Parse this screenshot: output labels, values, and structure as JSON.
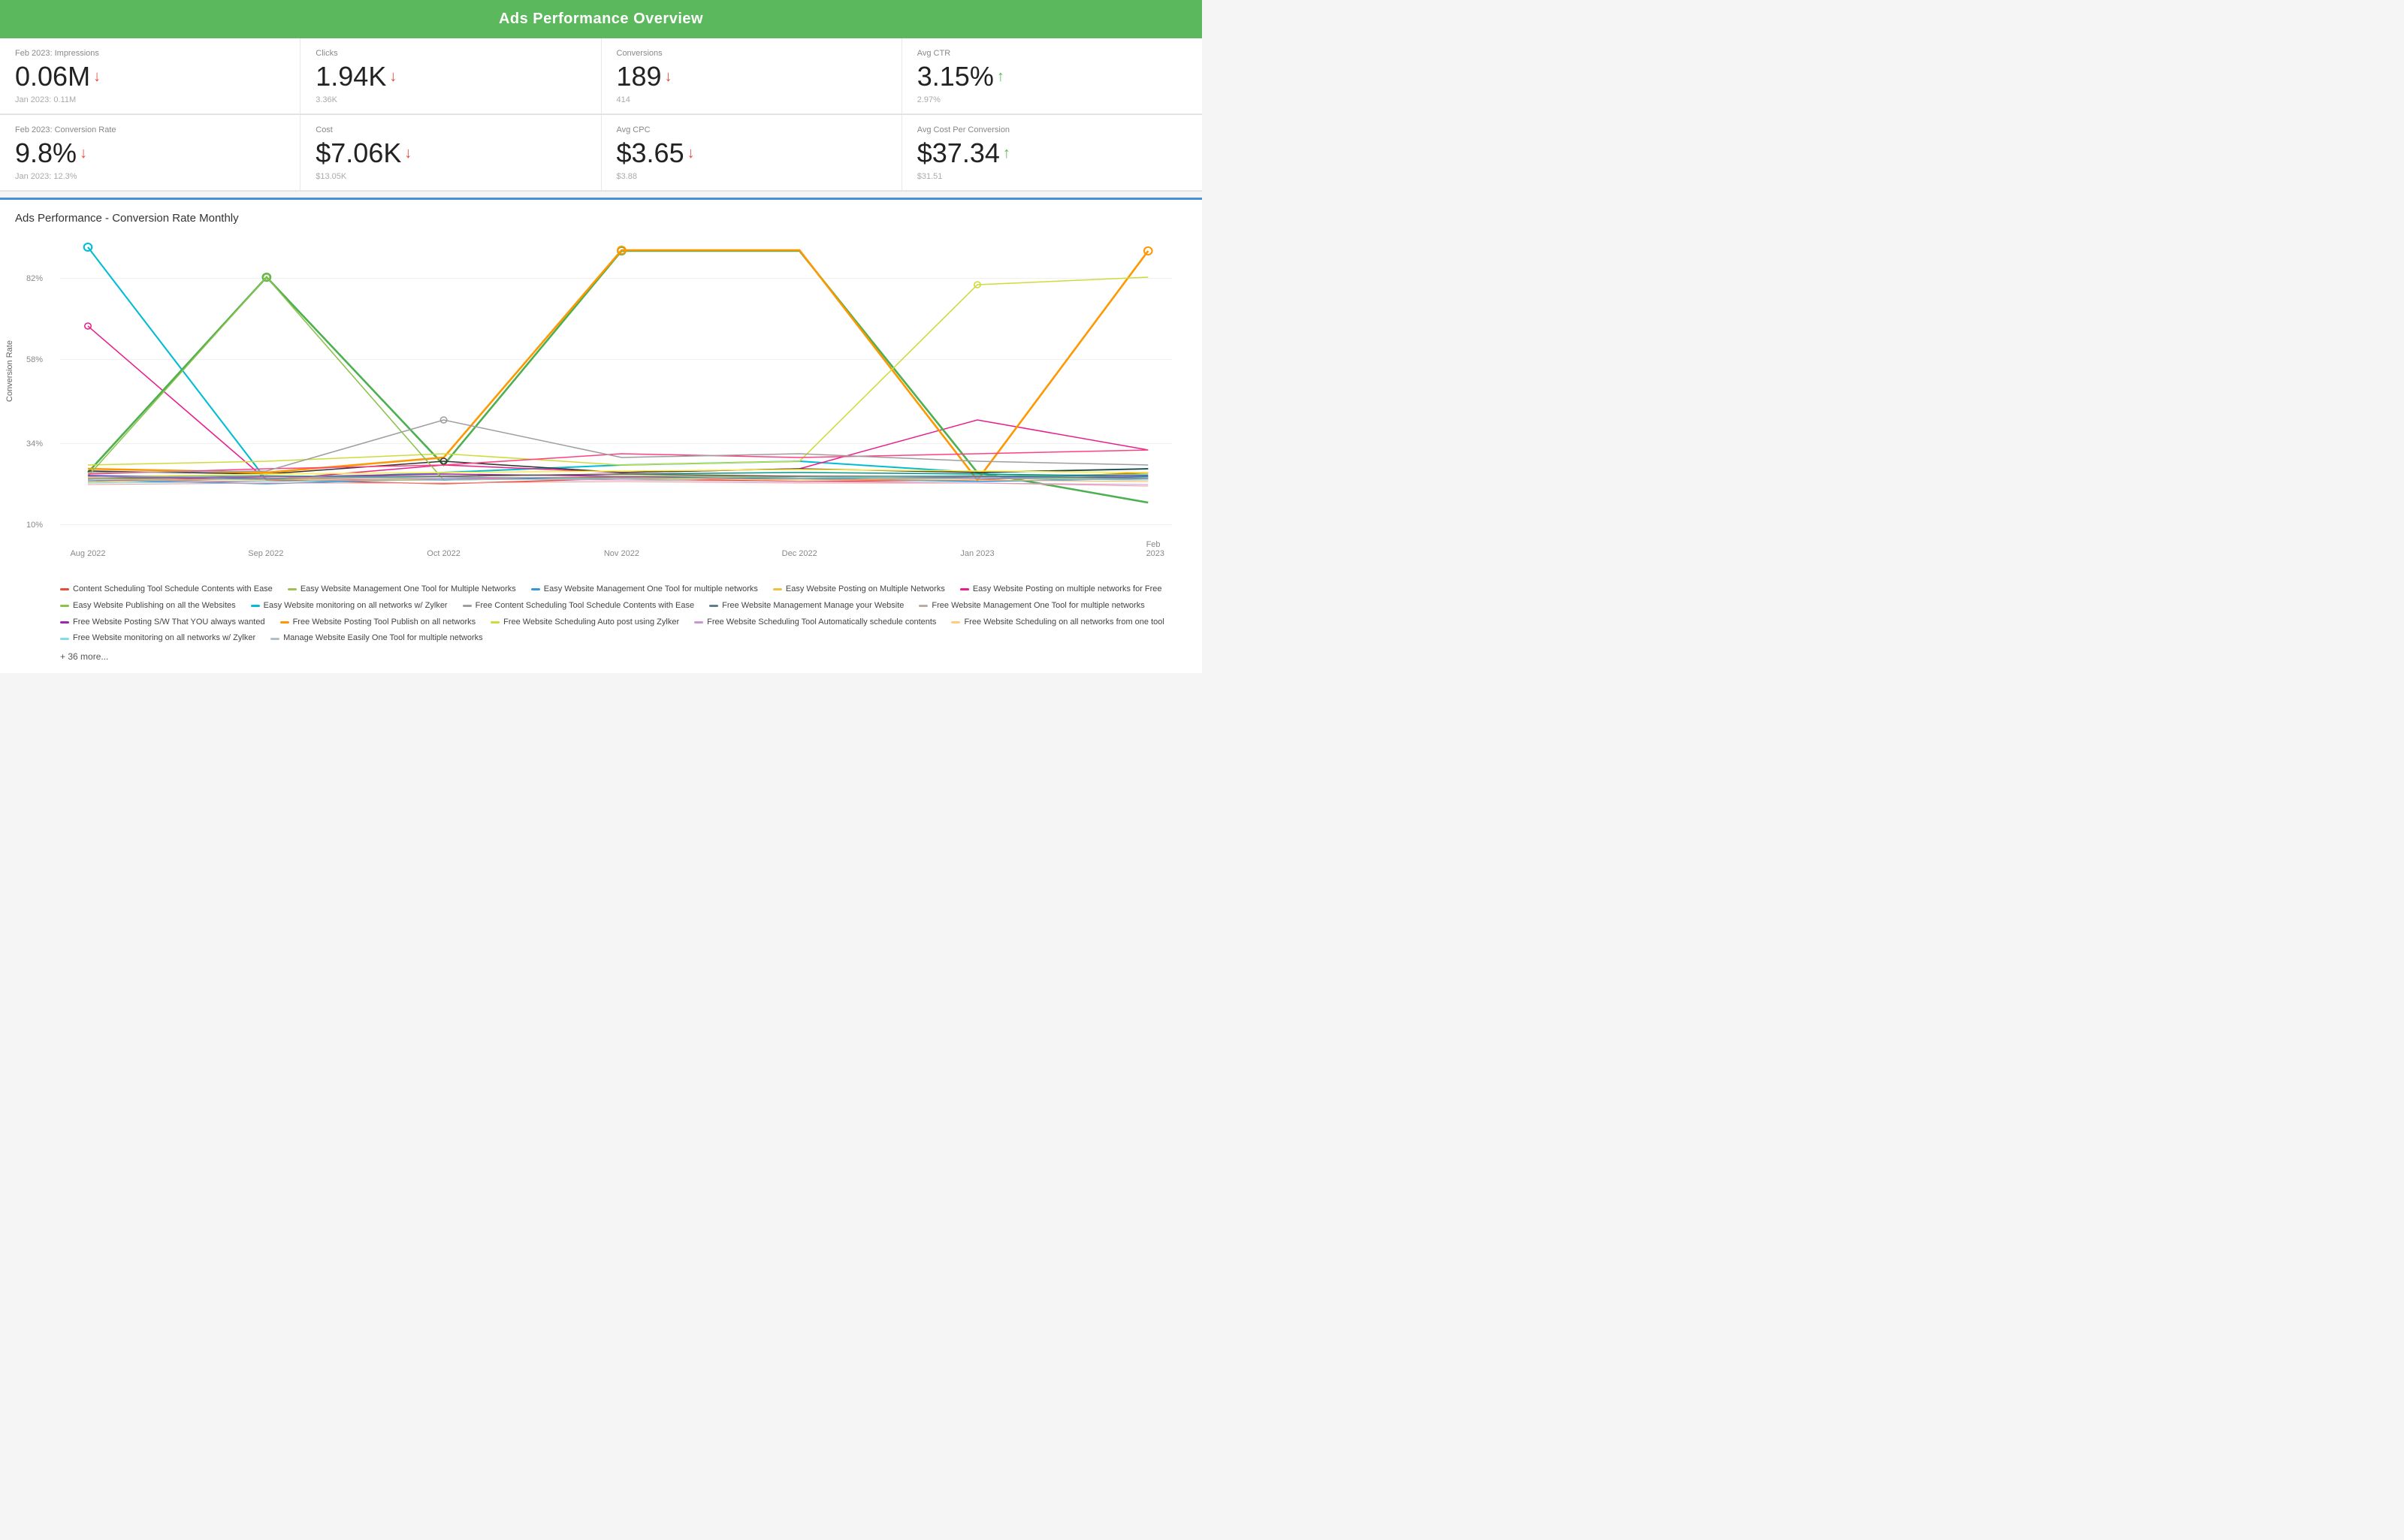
{
  "header": {
    "title": "Ads Performance Overview"
  },
  "metrics_row1": [
    {
      "label": "Feb 2023: Impressions",
      "value": "0.06M",
      "arrow": "down",
      "prev": "Jan 2023: 0.11M"
    },
    {
      "label": "Clicks",
      "value": "1.94K",
      "arrow": "down",
      "prev": "3.36K"
    },
    {
      "label": "Conversions",
      "value": "189",
      "arrow": "down",
      "prev": "414"
    },
    {
      "label": "Avg CTR",
      "value": "3.15%",
      "arrow": "up",
      "prev": "2.97%"
    }
  ],
  "metrics_row2": [
    {
      "label": "Feb 2023: Conversion Rate",
      "value": "9.8%",
      "arrow": "down",
      "prev": "Jan 2023: 12.3%"
    },
    {
      "label": "Cost",
      "value": "$7.06K",
      "arrow": "down",
      "prev": "$13.05K"
    },
    {
      "label": "Avg CPC",
      "value": "$3.65",
      "arrow": "down",
      "prev": "$3.88"
    },
    {
      "label": "Avg Cost Per Conversion",
      "value": "$37.34",
      "arrow": "up",
      "prev": "$31.51"
    }
  ],
  "chart": {
    "title": "Ads Performance - Conversion Rate Monthly",
    "y_axis_label": "Conversion Rate",
    "y_labels": [
      "10%",
      "34%",
      "58%",
      "82%"
    ],
    "x_labels": [
      "Aug 2022",
      "Sep 2022",
      "Oct 2022",
      "Nov 2022",
      "Dec 2022",
      "Jan 2023",
      "Feb 2023"
    ]
  },
  "legend": {
    "items": [
      {
        "label": "Content Scheduling Tool Schedule Contents with Ease",
        "color": "#e74c3c"
      },
      {
        "label": "Easy Website Management One Tool for Multiple Networks",
        "color": "#a0c050"
      },
      {
        "label": "Easy Website Management One Tool for multiple networks",
        "color": "#3498db"
      },
      {
        "label": "Easy Website Posting on Multiple Networks",
        "color": "#f0c040"
      },
      {
        "label": "Easy Website Posting on multiple networks for Free",
        "color": "#e91e8c"
      },
      {
        "label": "Easy Website Publishing on all the Websites",
        "color": "#8bc34a"
      },
      {
        "label": "Easy Website monitoring on all networks w/ Zylker",
        "color": "#00bcd4"
      },
      {
        "label": "Free Content Scheduling Tool Schedule Contents with Ease",
        "color": "#9e9e9e"
      },
      {
        "label": "Free Website Management Manage your Website",
        "color": "#607d8b"
      },
      {
        "label": "Free Website Management One Tool for multiple networks",
        "color": "#bcaaa4"
      },
      {
        "label": "Free Website Posting S/W That YOU always wanted",
        "color": "#9c27b0"
      },
      {
        "label": "Free Website Posting Tool Publish on all networks",
        "color": "#ff9800"
      },
      {
        "label": "Free Website Scheduling Auto post using Zylker",
        "color": "#cddc39"
      },
      {
        "label": "Free Website Scheduling Tool Automatically schedule contents",
        "color": "#ce93d8"
      },
      {
        "label": "Free Website Scheduling on all networks from one tool",
        "color": "#ffcc80"
      },
      {
        "label": "Free Website monitoring on all networks w/ Zylker",
        "color": "#80deea"
      },
      {
        "label": "Manage Website Easily One Tool for multiple networks",
        "color": "#b0bec5"
      }
    ],
    "more": "+ 36 more..."
  }
}
